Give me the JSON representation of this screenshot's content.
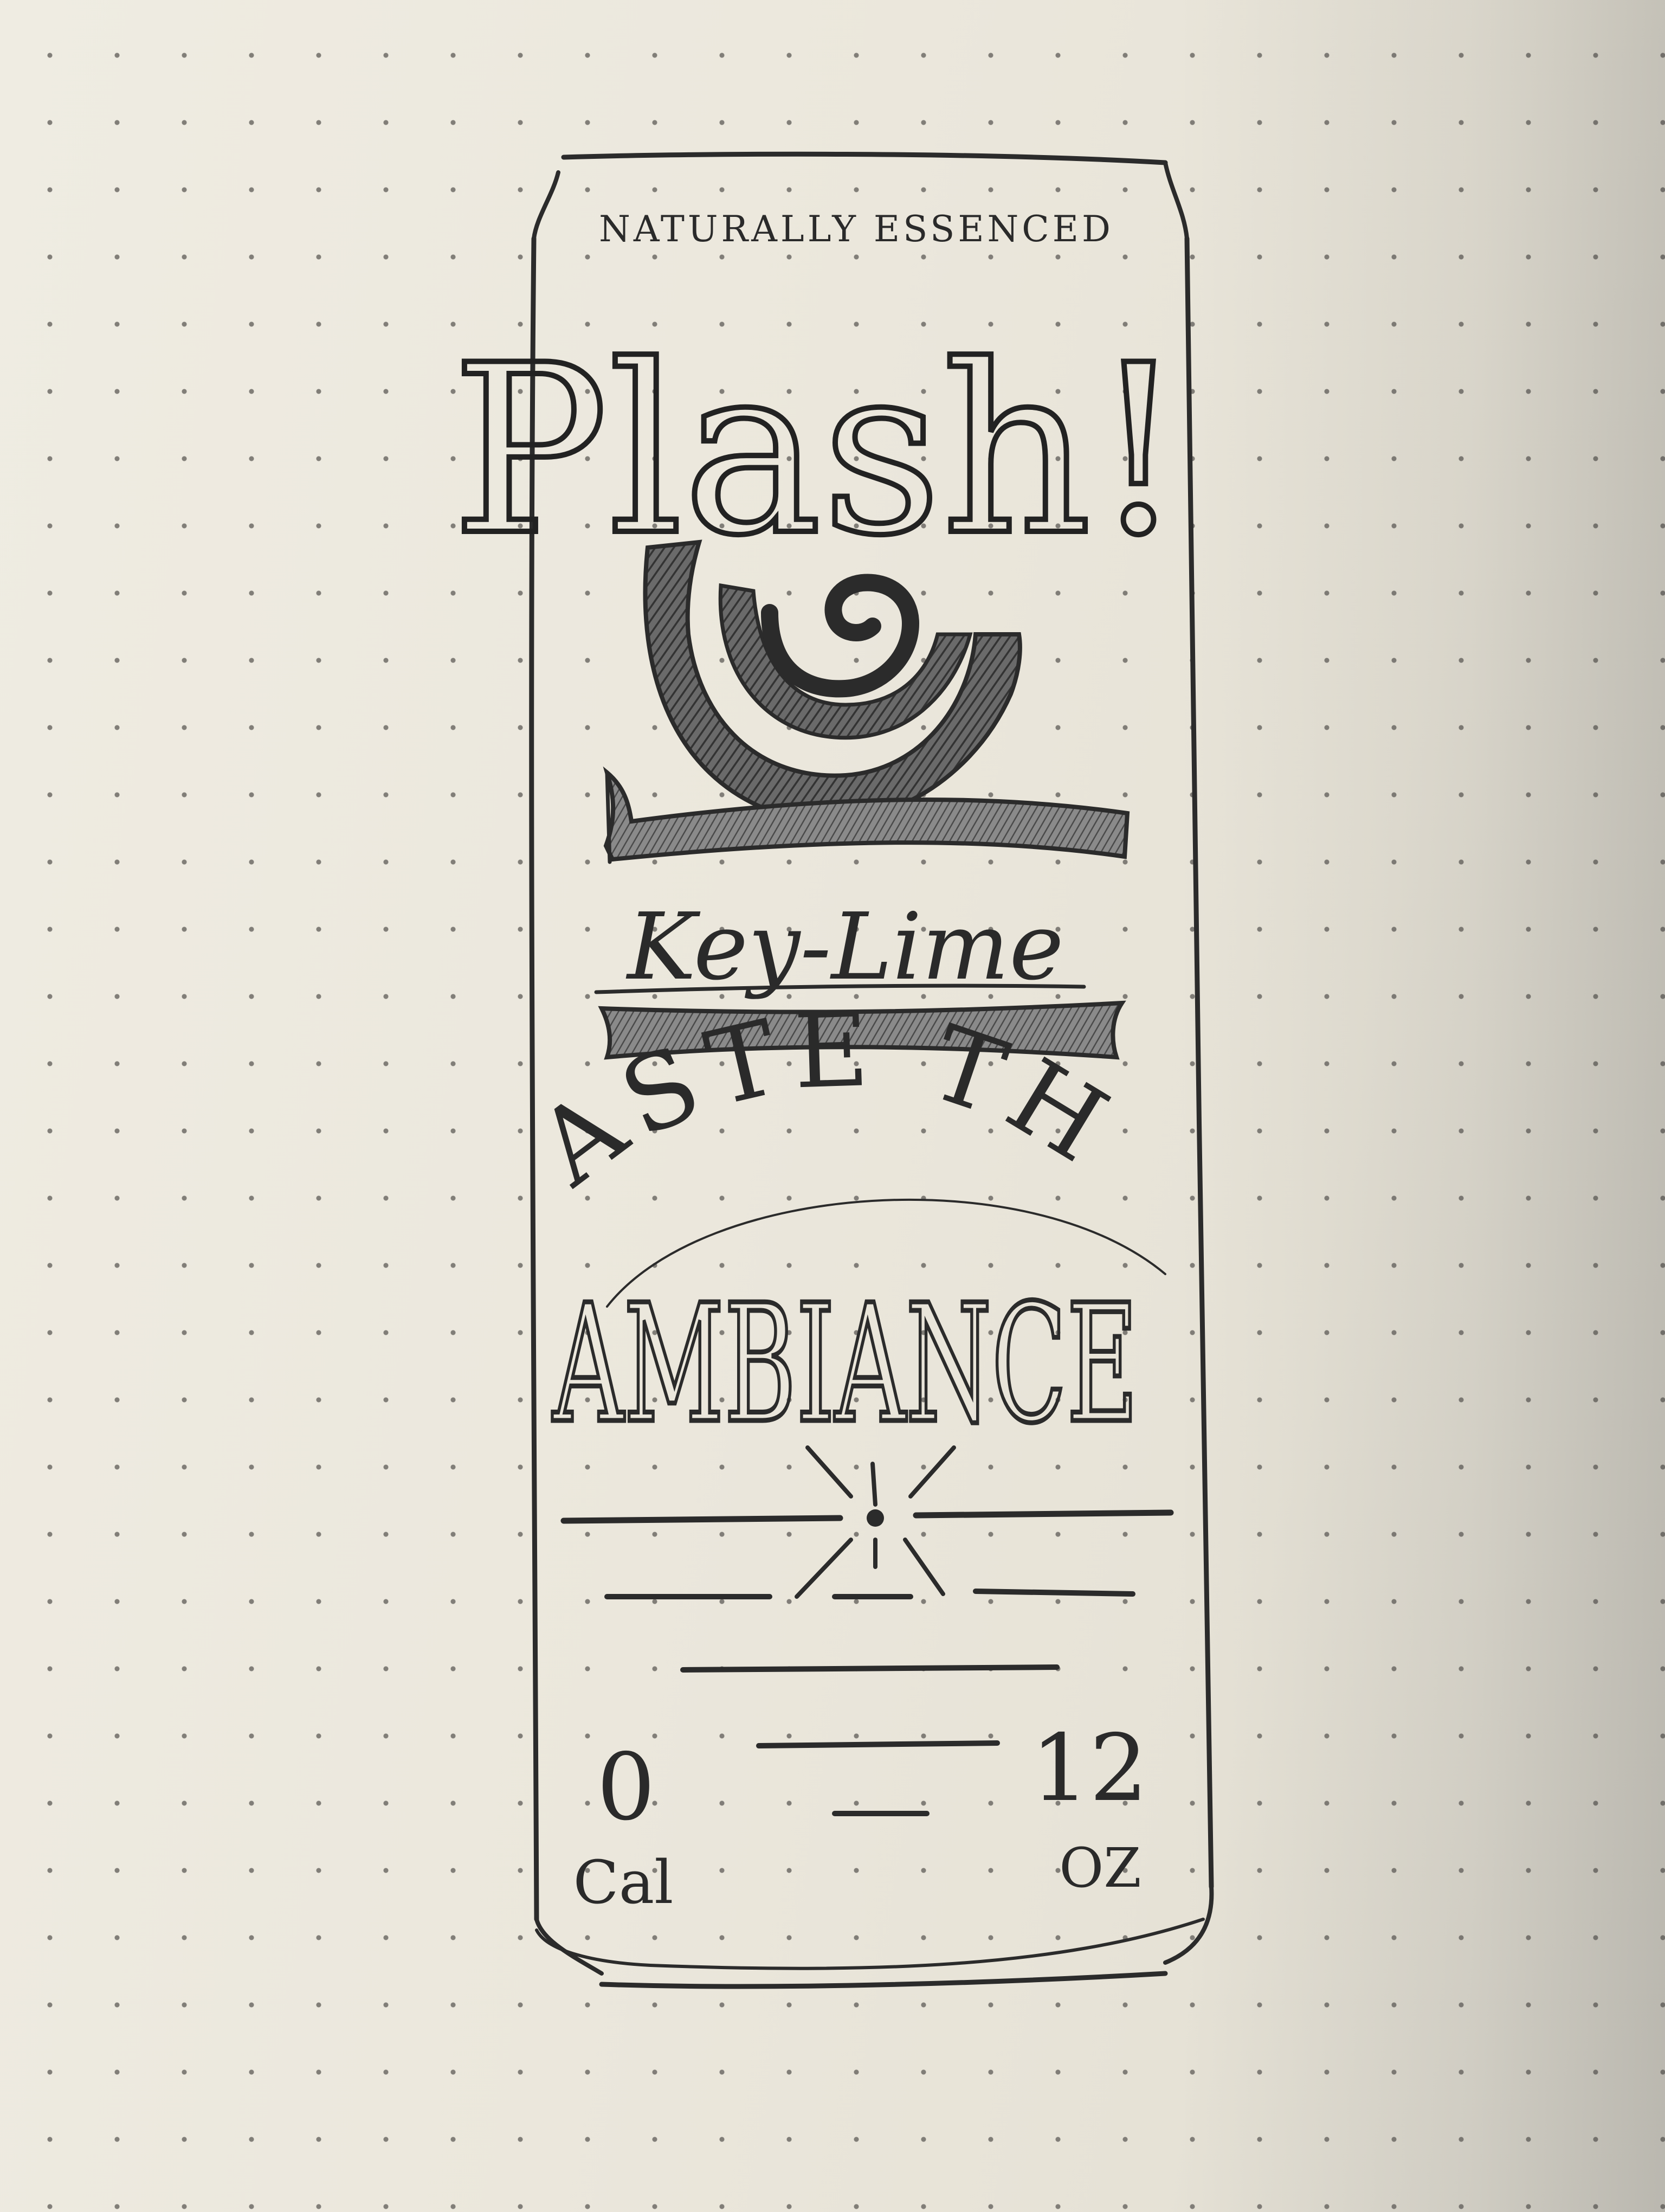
{
  "can": {
    "tagline": "NATURALLY ESSENCED",
    "brand": "Plash!",
    "flavor": "Key-Lime",
    "slogan_line1": "TASTE THE",
    "slogan_line2": "AMBIANCE",
    "calories_value": "0",
    "calories_unit": "Cal",
    "volume_value": "12",
    "volume_unit": "OZ"
  },
  "colors": {
    "paper": "#ebe7dc",
    "graphite": "#2b2b2b",
    "shading": "#555555"
  }
}
